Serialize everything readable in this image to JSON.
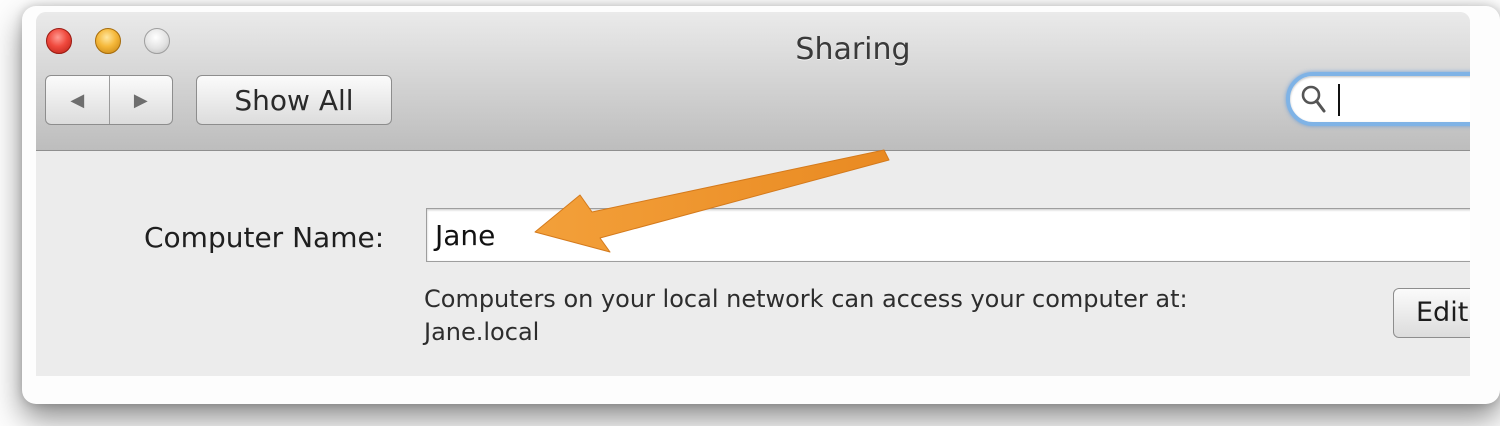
{
  "window": {
    "title": "Sharing"
  },
  "toolbar": {
    "back_icon": "◀",
    "forward_icon": "▶",
    "show_all_label": "Show All",
    "search_value": ""
  },
  "content": {
    "computer_name_label": "Computer Name:",
    "computer_name_value": "Jane",
    "info_line1": "Computers on your local network can access your computer at:",
    "info_line2": "Jane.local",
    "edit_button_label": "Edit..."
  },
  "colors": {
    "annotation_arrow": "#f0962e",
    "search_focus_ring": "#7fb3e6"
  },
  "icons": {
    "close": "close-button-icon",
    "minimize": "minimize-button-icon",
    "zoom": "zoom-button-icon",
    "search": "magnifier-icon",
    "annotation": "orange-arrow-icon"
  }
}
